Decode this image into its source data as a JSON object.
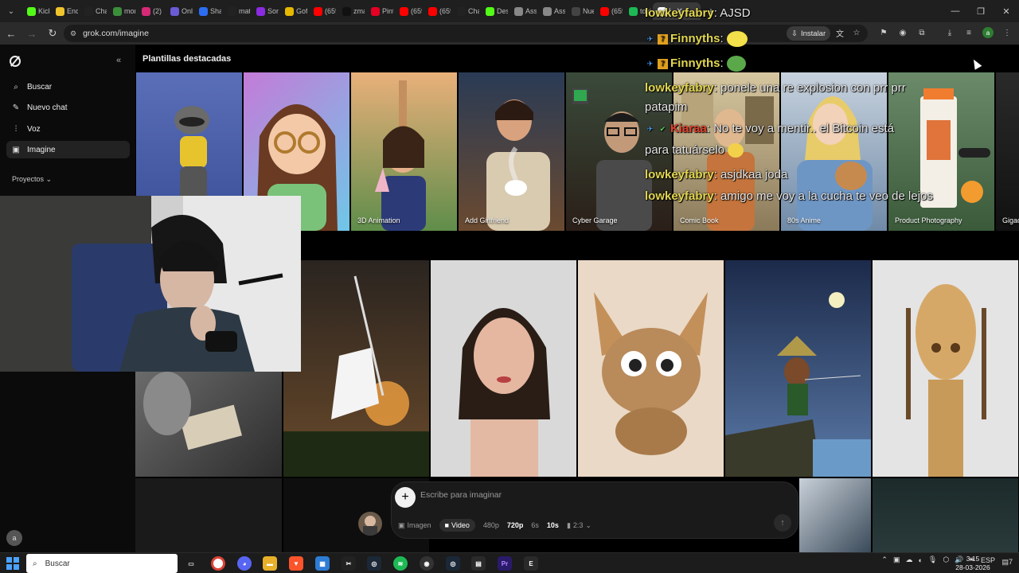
{
  "browser": {
    "tabs": [
      {
        "label": "Kick",
        "color": "#53fc18"
      },
      {
        "label": "Encu",
        "color": "#f0c52b"
      },
      {
        "label": "Chat",
        "color": "#222222"
      },
      {
        "label": "mon",
        "color": "#3b8f3b"
      },
      {
        "label": "(2) In",
        "color": "#d62976"
      },
      {
        "label": "Onli",
        "color": "#6b5bd6"
      },
      {
        "label": "Shar",
        "color": "#2c6ef2"
      },
      {
        "label": "mat",
        "color": "#222222"
      },
      {
        "label": "Sons",
        "color": "#8a2be2"
      },
      {
        "label": "Gofi",
        "color": "#e6b800"
      },
      {
        "label": "(659",
        "color": "#ff0000"
      },
      {
        "label": "zmar",
        "color": "#111111"
      },
      {
        "label": "Pinte",
        "color": "#e60023"
      },
      {
        "label": "(659",
        "color": "#ff0000"
      },
      {
        "label": "(659",
        "color": "#ff0000"
      },
      {
        "label": "Chat",
        "color": "#222222"
      },
      {
        "label": "Des",
        "color": "#53fc18"
      },
      {
        "label": "Ass",
        "color": "#888888"
      },
      {
        "label": "Ass",
        "color": "#888888"
      },
      {
        "label": "Nue",
        "color": "#444444"
      },
      {
        "label": "(659",
        "color": "#ff0000"
      },
      {
        "label": "toxic",
        "color": "#1db954"
      }
    ],
    "active_tab": {
      "label": "I"
    },
    "new_tab_icon": "+",
    "url": "grok.com/imagine",
    "install_label": "Instalar"
  },
  "sidebar": {
    "items": [
      {
        "label": "Buscar",
        "icon": "search-icon"
      },
      {
        "label": "Nuevo chat",
        "icon": "edit-icon"
      },
      {
        "label": "Voz",
        "icon": "voice-icon"
      },
      {
        "label": "Imagine",
        "icon": "image-icon"
      }
    ],
    "projects_label": "Proyectos",
    "avatar_letter": "a"
  },
  "main": {
    "section_title": "Plantillas destacadas",
    "templates": [
      {
        "label": ""
      },
      {
        "label": ""
      },
      {
        "label": "3D Animation"
      },
      {
        "label": "Add Girlfriend"
      },
      {
        "label": "Cyber Garage"
      },
      {
        "label": "Comic Book"
      },
      {
        "label": "80s Anime"
      },
      {
        "label": "Product Photography"
      },
      {
        "label": "Gigac"
      }
    ]
  },
  "composer": {
    "placeholder": "Escribe para imaginar",
    "mode_image": "Imagen",
    "mode_video": "Video",
    "res_480": "480p",
    "res_720": "720p",
    "dur_6": "6s",
    "dur_10": "10s",
    "aspect": "2:3"
  },
  "chat": {
    "lines": [
      {
        "user": "lowkeyfabry",
        "text": ": AJSD"
      },
      {
        "user": "Finnyths",
        "text": ":"
      },
      {
        "user": "Finnyths",
        "text": ":"
      },
      {
        "user": "lowkeyfabry",
        "text": ": ponele una re explosion con prr prr"
      },
      {
        "user": "",
        "text": "patapim"
      },
      {
        "user": "Kiaraa",
        "text": ": No te voy a mentir.. el Bitcoin está"
      },
      {
        "user": "",
        "text": "para tatuárselo"
      },
      {
        "user": "lowkeyfabry",
        "text": ": asjdkaa joda"
      },
      {
        "user": "lowkeyfabry",
        "text": ": amigo me voy a la cucha te veo de lejos"
      }
    ]
  },
  "taskbar": {
    "search_label": "Buscar",
    "language": "ESP",
    "time": "3:15",
    "date": "28-03-2026",
    "notif_count": "7"
  }
}
